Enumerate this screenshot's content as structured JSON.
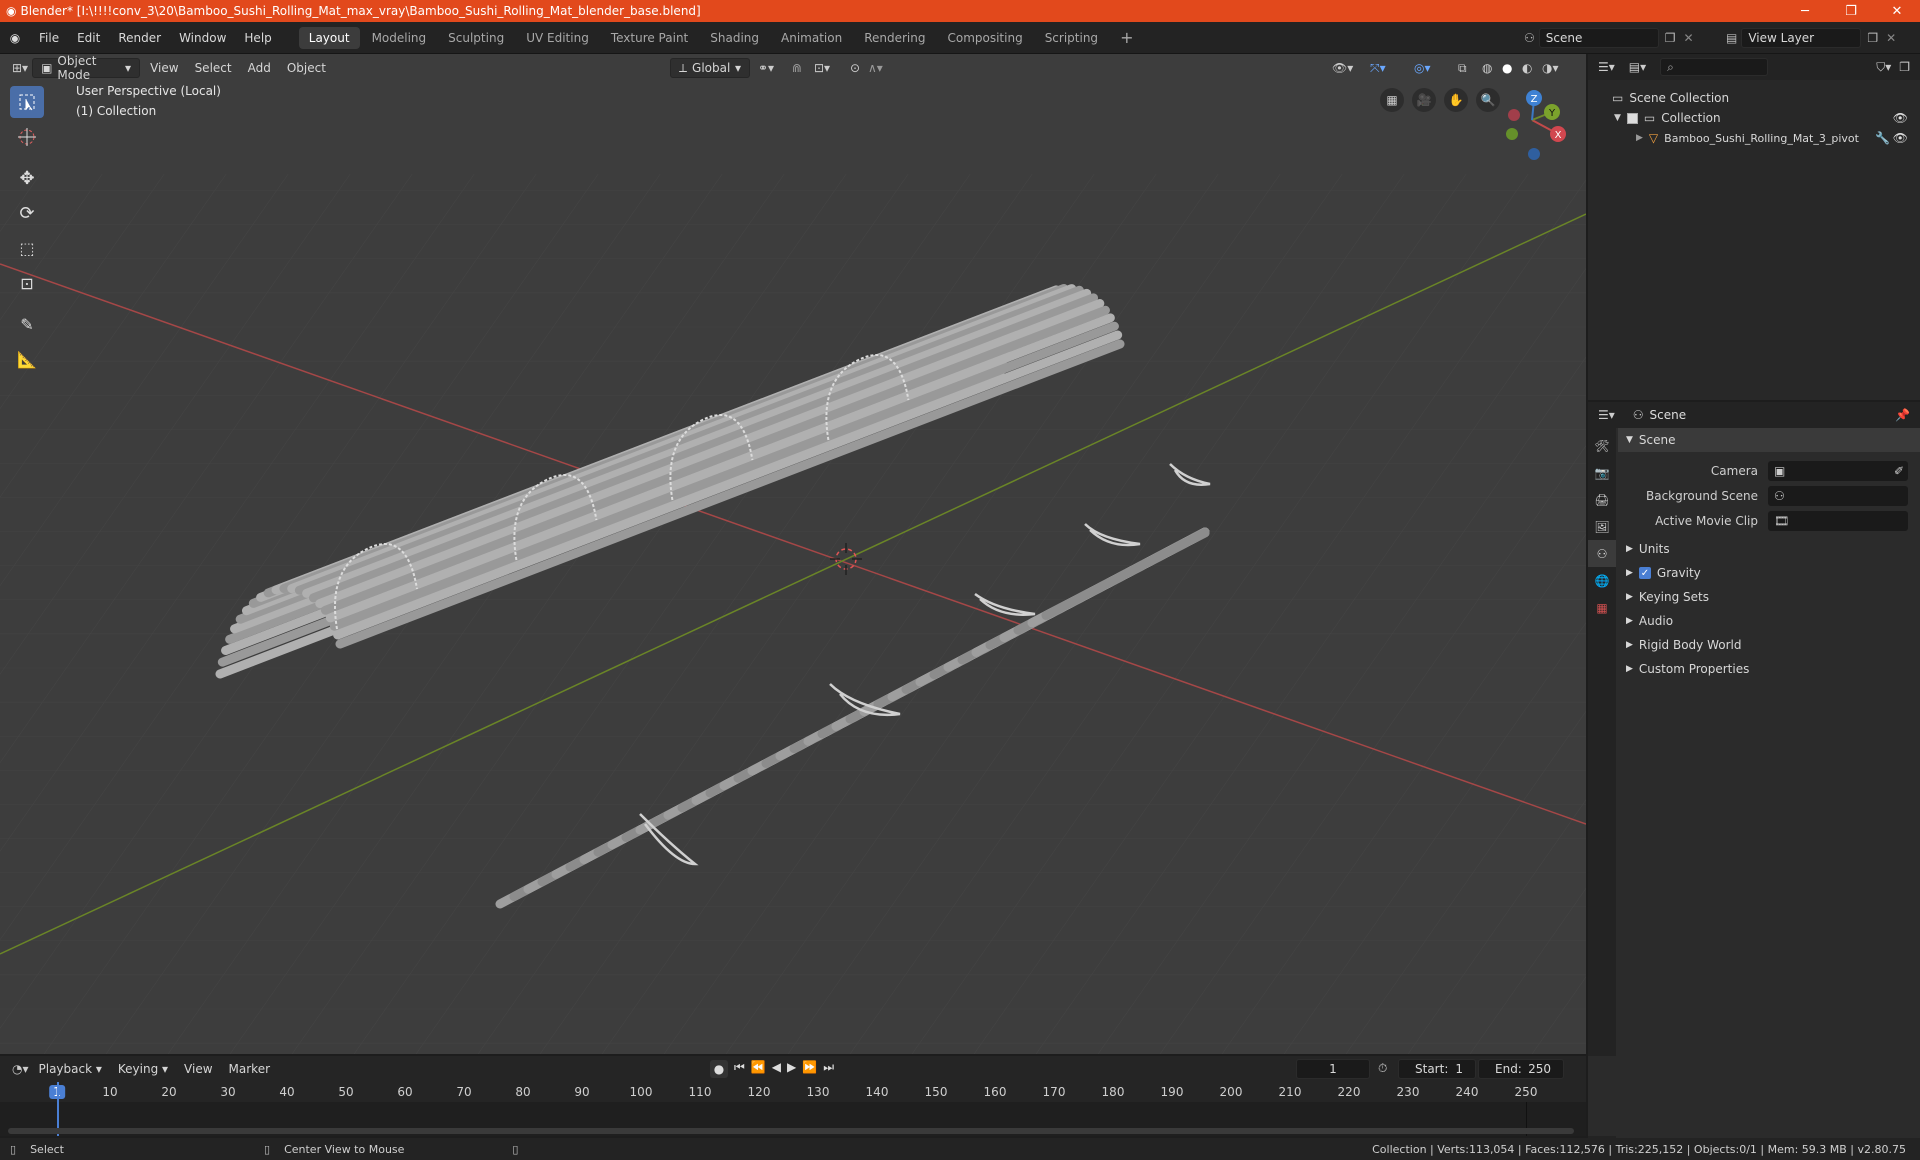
{
  "titlebar": {
    "title": "Blender* [I:\\!!!!conv_3\\20\\Bamboo_Sushi_Rolling_Mat_max_vray\\Bamboo_Sushi_Rolling_Mat_blender_base.blend]",
    "minimize": "─",
    "maximize": "❐",
    "close": "✕"
  },
  "menubar": {
    "items": [
      "File",
      "Edit",
      "Render",
      "Window",
      "Help"
    ],
    "workspaces": [
      "Layout",
      "Modeling",
      "Sculpting",
      "UV Editing",
      "Texture Paint",
      "Shading",
      "Animation",
      "Rendering",
      "Compositing",
      "Scripting"
    ],
    "active_workspace": "Layout",
    "add_workspace": "+",
    "scene_name": "Scene",
    "view_layer_name": "View Layer"
  },
  "viewport": {
    "mode": "Object Mode",
    "menus": [
      "View",
      "Select",
      "Add",
      "Object"
    ],
    "transform_orientation": "Global",
    "perspective_label": "User Perspective (Local)",
    "collection_label": "(1) Collection",
    "gizmo": {
      "x": "X",
      "y": "Y",
      "z": "Z"
    }
  },
  "outliner": {
    "root": "Scene Collection",
    "collection": "Collection",
    "object": "Bamboo_Sushi_Rolling_Mat_3_pivot"
  },
  "properties": {
    "header": "Scene",
    "section": "Scene",
    "fields": [
      {
        "label": "Camera",
        "value": ""
      },
      {
        "label": "Background Scene",
        "value": ""
      },
      {
        "label": "Active Movie Clip",
        "value": ""
      }
    ],
    "subpanels": [
      "Units",
      "Gravity",
      "Keying Sets",
      "Audio",
      "Rigid Body World",
      "Custom Properties"
    ],
    "gravity_enabled": true
  },
  "timeline": {
    "menus": [
      "Playback",
      "Keying",
      "View",
      "Marker"
    ],
    "current_frame": "1",
    "start_label": "Start:",
    "start": "1",
    "end_label": "End:",
    "end": "250",
    "ruler": [
      "1",
      "10",
      "20",
      "30",
      "40",
      "50",
      "60",
      "70",
      "80",
      "90",
      "100",
      "110",
      "120",
      "130",
      "140",
      "150",
      "160",
      "170",
      "180",
      "190",
      "200",
      "210",
      "220",
      "230",
      "240",
      "250"
    ]
  },
  "statusbar": {
    "select": "Select",
    "center_view": "Center View to Mouse",
    "stats": "Collection | Verts:113,054 | Faces:112,576 | Tris:225,152 | Objects:0/1 | Mem: 59.3 MB | v2.80.75"
  },
  "colors": {
    "titlebar": "#e2491c",
    "active_tool": "#4a6ea8",
    "axis_x": "#c24a4a",
    "axis_y": "#6e8a2a",
    "axis_z": "#3b78c4"
  }
}
